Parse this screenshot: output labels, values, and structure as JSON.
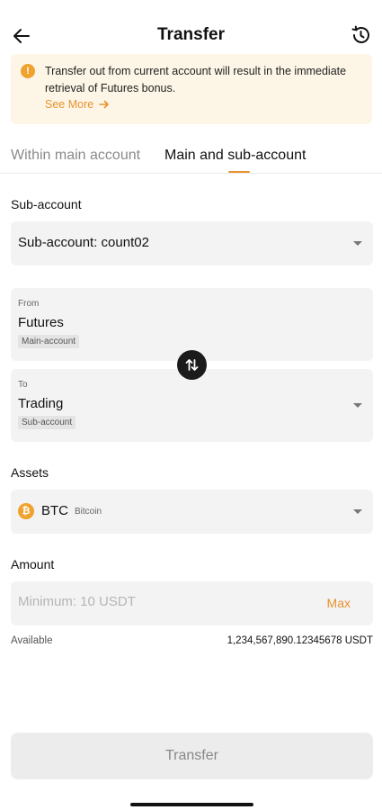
{
  "header": {
    "title": "Transfer",
    "back_icon": "arrow-left-icon",
    "history_icon": "history-icon"
  },
  "notice": {
    "icon": "info-icon",
    "text": "Transfer out from current account will result in the immediate retrieval of Futures bonus.",
    "link_label": "See More",
    "link_icon": "arrow-right-icon"
  },
  "tabs": [
    {
      "label": "Within main account",
      "active": false
    },
    {
      "label": "Main and sub-account",
      "active": true
    }
  ],
  "sub_account": {
    "section_label": "Sub-account",
    "selected": "Sub-account: count02"
  },
  "from": {
    "label": "From",
    "account": "Futures",
    "tag": "Main-account"
  },
  "to": {
    "label": "To",
    "account": "Trading",
    "tag": "Sub-account"
  },
  "assets": {
    "section_label": "Assets",
    "symbol": "BTC",
    "name": "Bitcoin",
    "icon": "bitcoin-icon"
  },
  "amount": {
    "section_label": "Amount",
    "placeholder": "Minimum: 10 USDT",
    "value": "",
    "max_label": "Max"
  },
  "available": {
    "label": "Available",
    "value": "1,234,567,890.12345678 USDT"
  },
  "submit": {
    "label": "Transfer"
  },
  "colors": {
    "accent": "#e8922e",
    "notice_bg": "#fdf6e7",
    "field_bg": "#f3f3f3",
    "button_disabled_bg": "#ececec"
  }
}
